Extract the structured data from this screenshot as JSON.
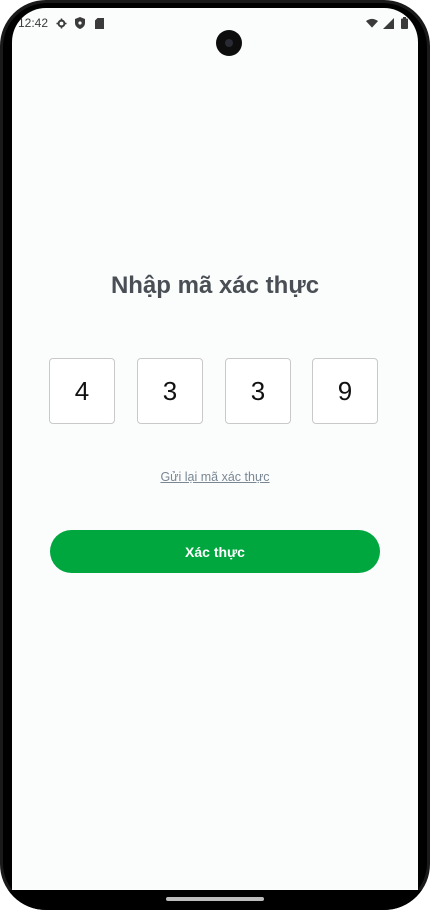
{
  "status_bar": {
    "time": "12:42",
    "left_icons": [
      "settings-icon",
      "shield-icon",
      "sd-card-icon"
    ],
    "right_icons": [
      "wifi-icon",
      "signal-icon",
      "battery-icon"
    ]
  },
  "screen": {
    "title": "Nhập mã xác thực",
    "otp_digits": [
      "4",
      "3",
      "3",
      "9"
    ],
    "resend_link": "Gửi lại mã xác thực",
    "verify_button": "Xác thực"
  },
  "colors": {
    "accent": "#00a63e",
    "title": "#4a4f55",
    "link": "#7a8793"
  }
}
